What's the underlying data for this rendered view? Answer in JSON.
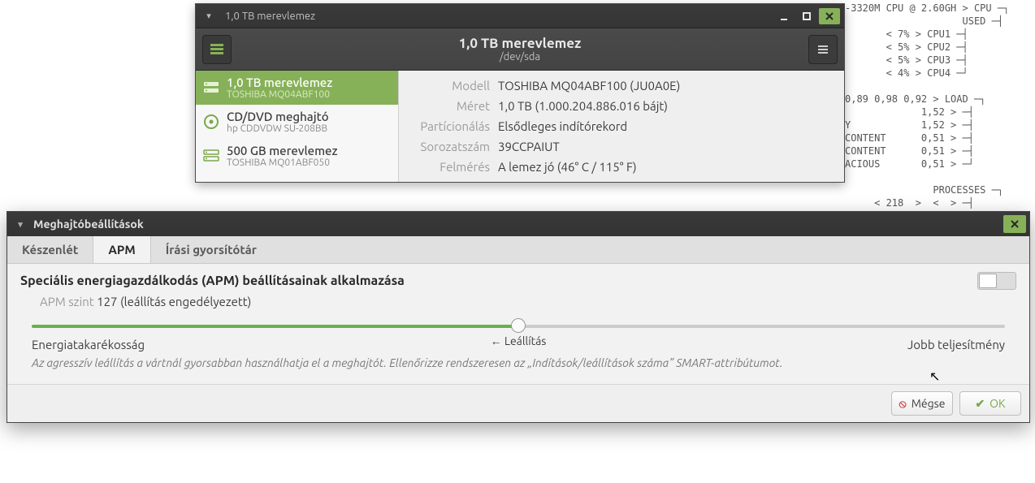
{
  "term": {
    "lines": [
      "-3320M CPU @ 2.60GH > CPU ─┐",
      "                    USED ─┤",
      "       < 7% > CPU1 ─┤",
      "       < 5% > CPU2 ─┤",
      "       < 5% > CPU3 ─┤",
      "       < 4% > CPU4 ─┘",
      "",
      "0,89 0,98 0,92 > LOAD ─┐",
      "             1,52 > ─┤",
      "Y            1,52 > ─┤",
      "CONTENT      0,51 > ─┤",
      "CONTENT      0,51 > ─┤",
      "ACIOUS       0,51 > ─┘",
      "",
      "               PROCESSES ─┐",
      "     < 218  >  <  > ─┤"
    ]
  },
  "win1": {
    "titlebar": "1,0 TB merevlemez",
    "header_title": "1,0 TB merevlemez",
    "header_sub": "/dev/sda",
    "sidebar": [
      {
        "l1": "1,0 TB merevlemez",
        "l2": "TOSHIBA MQ04ABF100",
        "icon": "hdd"
      },
      {
        "l1": "CD/DVD meghajtó",
        "l2": "hp      CDDVDW SU-208BB",
        "icon": "disc"
      },
      {
        "l1": "500 GB merevlemez",
        "l2": "TOSHIBA MQ01ABF050",
        "icon": "hdd"
      }
    ],
    "details": {
      "model_lbl": "Modell",
      "model_val": "TOSHIBA MQ04ABF100 (JU0A0E)",
      "size_lbl": "Méret",
      "size_val": "1,0 TB (1.000.204.886.016 bájt)",
      "part_lbl": "Partícionálás",
      "part_val": "Elsődleges indítórekord",
      "serial_lbl": "Sorozatszám",
      "serial_val": "39CCPAIUT",
      "assess_lbl": "Felmérés",
      "assess_val": "A lemez jó (46° C / 115° F)"
    }
  },
  "dlg": {
    "title": "Meghajtóbeállítások",
    "tabs": {
      "standby": "Készenlét",
      "apm": "APM",
      "wc": "Írási gyorsítótár"
    },
    "heading": "Speciális energiagazdálkodás (APM) beállításainak alkalmazása",
    "apm_lbl": "APM szint",
    "apm_val": "127 (leállítás engedélyezett)",
    "slider": {
      "left": "Energiatakarékosság",
      "mid": "← Leállítás",
      "right": "Jobb teljesítmény"
    },
    "warn": "Az agresszív leállítás a vártnál gyorsabban használhatja el a meghajtót. Ellenőrizze rendszeresen az „Indítások/leállítások száma” SMART-attribútumot.",
    "btn_cancel": "Mégse",
    "btn_ok": "OK"
  }
}
